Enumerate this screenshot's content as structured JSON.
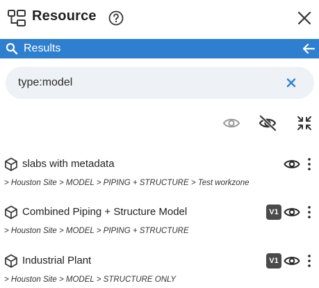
{
  "header": {
    "title": "Resource"
  },
  "results_bar": {
    "label": "Results",
    "color": "#2f7fd0"
  },
  "search": {
    "value": "type:model",
    "clear_color": "#2f7fd0"
  },
  "toolbar": {
    "icons": [
      "show-all-icon",
      "hide-all-icon",
      "collapse-icon"
    ]
  },
  "items": [
    {
      "name": "slabs with metadata",
      "path": "> Houston Site > MODEL > PIPING + STRUCTURE > Test workzone",
      "badge": ""
    },
    {
      "name": "Combined Piping + Structure Model",
      "path": "> Houston Site > MODEL > PIPING + STRUCTURE",
      "badge": "V1"
    },
    {
      "name": "Industrial Plant",
      "path": "> Houston Site > MODEL > STRUCTURE ONLY",
      "badge": "V1"
    }
  ]
}
